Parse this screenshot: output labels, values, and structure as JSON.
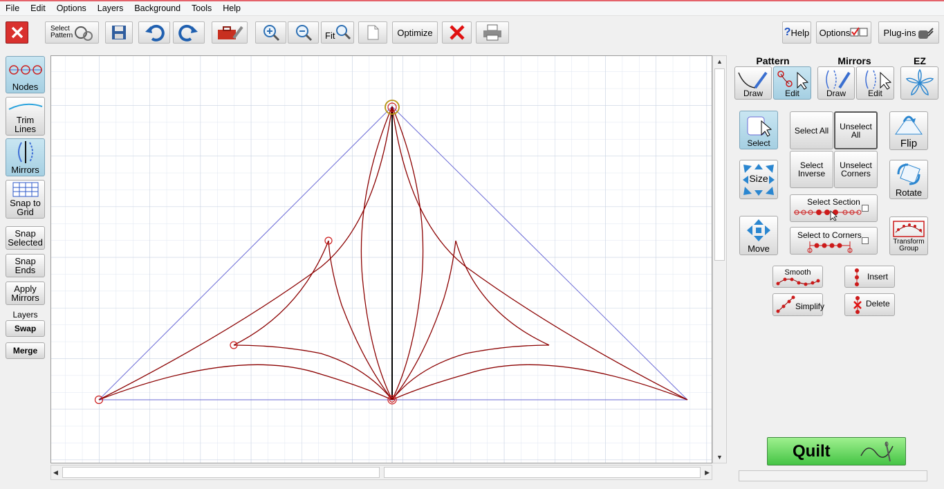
{
  "menu": [
    "File",
    "Edit",
    "Options",
    "Layers",
    "Background",
    "Tools",
    "Help"
  ],
  "toolbar": {
    "select_pattern_line1": "Select",
    "select_pattern_line2": "Pattern",
    "fit_label": "Fit",
    "optimize_label": "Optimize",
    "help_label": "Help",
    "options_label": "Options",
    "plugins_label": "Plug-ins"
  },
  "left_panel": {
    "nodes": "Nodes",
    "trim_lines_1": "Trim",
    "trim_lines_2": "Lines",
    "mirrors": "Mirrors",
    "snap_grid_1": "Snap to",
    "snap_grid_2": "Grid",
    "snap_selected_1": "Snap",
    "snap_selected_2": "Selected",
    "snap_ends_1": "Snap",
    "snap_ends_2": "Ends",
    "apply_mirrors_1": "Apply",
    "apply_mirrors_2": "Mirrors",
    "layers": "Layers",
    "swap": "Swap",
    "merge": "Merge"
  },
  "right_panel": {
    "pattern_heading": "Pattern",
    "mirrors_heading": "Mirrors",
    "ez_heading": "EZ",
    "pattern_draw": "Draw",
    "pattern_edit": "Edit",
    "mirrors_draw": "Draw",
    "mirrors_edit": "Edit",
    "select": "Select",
    "select_all": "Select All",
    "unselect_all_1": "Unselect",
    "unselect_all_2": "All",
    "flip": "Flip",
    "size": "Size",
    "select_inverse_1": "Select",
    "select_inverse_2": "Inverse",
    "unselect_corners_1": "Unselect",
    "unselect_corners_2": "Corners",
    "rotate": "Rotate",
    "select_section": "Select Section",
    "move": "Move",
    "select_to_corners": "Select to Corners",
    "transform_group_1": "Transform",
    "transform_group_2": "Group",
    "smooth": "Smooth",
    "insert": "Insert",
    "simplify": "Simplify",
    "delete": "Delete",
    "quilt": "Quilt"
  },
  "colors": {
    "accent_red": "#e4626a",
    "pattern_line": "#8b0000",
    "mirror_line": "#6b6bd6",
    "grid_minor": "#dfe6f0",
    "quilt_green": "#45c445"
  }
}
